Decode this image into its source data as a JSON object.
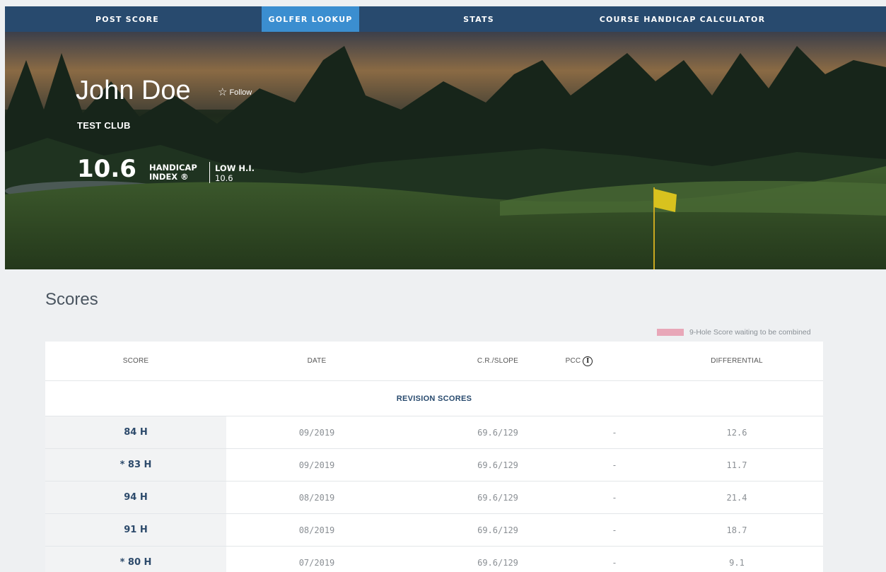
{
  "nav": {
    "items": [
      {
        "label": "POST SCORE",
        "active": false
      },
      {
        "label": "GOLFER LOOKUP",
        "active": true
      },
      {
        "label": "STATS",
        "active": false
      },
      {
        "label": "COURSE HANDICAP CALCULATOR",
        "active": false
      }
    ]
  },
  "golfer": {
    "name": "John Doe",
    "follow_label": "Follow",
    "club": "TEST CLUB",
    "handicap_index": "10.6",
    "handicap_label_line1": "HANDICAP",
    "handicap_label_line2": "INDEX ®",
    "low_hi_label": "LOW H.I.",
    "low_hi_value": "10.6"
  },
  "scores": {
    "title": "Scores",
    "legend": "9-Hole Score waiting to be combined",
    "columns": {
      "score": "SCORE",
      "date": "DATE",
      "cr_slope": "C.R./SLOPE",
      "pcc": "PCC",
      "differential": "DIFFERENTIAL"
    },
    "section_label": "REVISION SCORES",
    "rows": [
      {
        "score": "84 H",
        "date": "09/2019",
        "cr_slope": "69.6/129",
        "pcc": "-",
        "differential": "12.6"
      },
      {
        "score": "* 83 H",
        "date": "09/2019",
        "cr_slope": "69.6/129",
        "pcc": "-",
        "differential": "11.7"
      },
      {
        "score": "94 H",
        "date": "08/2019",
        "cr_slope": "69.6/129",
        "pcc": "-",
        "differential": "21.4"
      },
      {
        "score": "91 H",
        "date": "08/2019",
        "cr_slope": "69.6/129",
        "pcc": "-",
        "differential": "18.7"
      },
      {
        "score": "* 80 H",
        "date": "07/2019",
        "cr_slope": "69.6/129",
        "pcc": "-",
        "differential": "9.1"
      }
    ]
  },
  "colors": {
    "nav_bg": "#284a6e",
    "nav_active": "#3b8ed0",
    "legend_swatch": "#e8a7b8",
    "score_text": "#2d4a6b"
  },
  "icons": {
    "follow": "star-outline-icon",
    "pcc_info": "info-circle-icon",
    "flag": "golf-flag-icon"
  }
}
